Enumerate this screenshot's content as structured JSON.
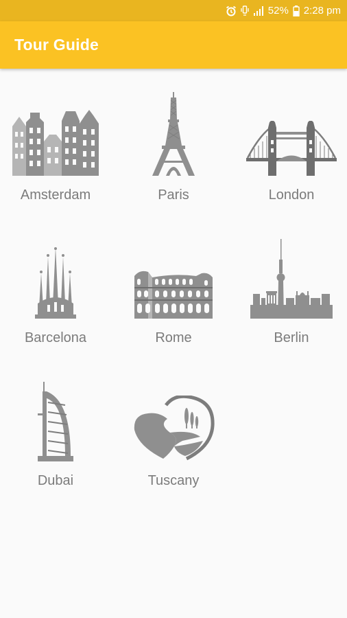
{
  "status_bar": {
    "battery": "52%",
    "time": "2:28 pm",
    "icons": [
      "alarm-icon",
      "vibrate-icon",
      "signal-icon",
      "battery-icon"
    ]
  },
  "app_bar": {
    "title": "Tour Guide"
  },
  "cities": [
    {
      "label": "Amsterdam",
      "icon": "amsterdam-houses-icon"
    },
    {
      "label": "Paris",
      "icon": "eiffel-tower-icon"
    },
    {
      "label": "London",
      "icon": "tower-bridge-icon"
    },
    {
      "label": "Barcelona",
      "icon": "sagrada-familia-icon"
    },
    {
      "label": "Rome",
      "icon": "colosseum-icon"
    },
    {
      "label": "Berlin",
      "icon": "berlin-skyline-icon"
    },
    {
      "label": "Dubai",
      "icon": "burj-al-arab-icon"
    },
    {
      "label": "Tuscany",
      "icon": "tuscany-heart-icon"
    }
  ],
  "colors": {
    "status_bar": "#e9b520",
    "app_bar": "#fbc223",
    "label_text": "#7b7b7b",
    "icon_gray": "#8f8f8f"
  }
}
